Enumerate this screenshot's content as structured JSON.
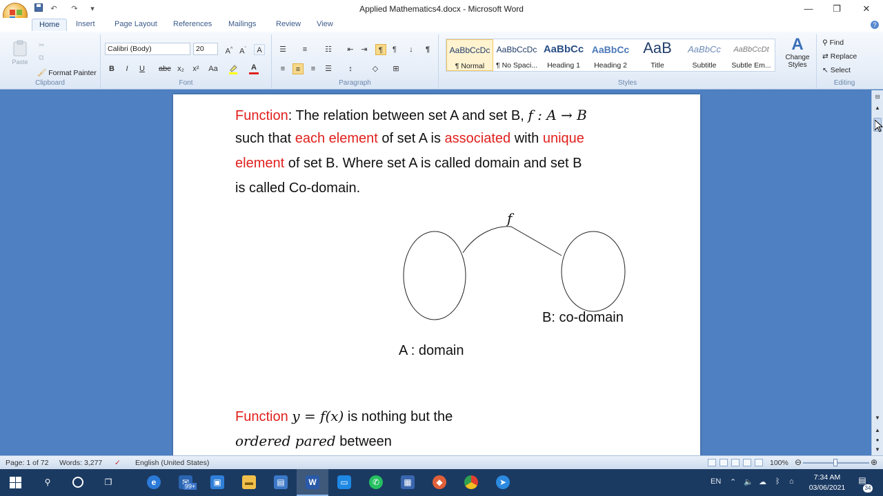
{
  "window": {
    "title": "Applied Mathematics4.docx - Microsoft Word",
    "minimize": "—",
    "restore": "❐",
    "close": "✕"
  },
  "tabs": [
    {
      "label": "Home",
      "active": true
    },
    {
      "label": "Insert"
    },
    {
      "label": "Page Layout"
    },
    {
      "label": "References"
    },
    {
      "label": "Mailings"
    },
    {
      "label": "Review"
    },
    {
      "label": "View"
    }
  ],
  "ribbon": {
    "clipboard": {
      "paste": "Paste",
      "format_painter": "Format Painter",
      "label": "Clipboard"
    },
    "font": {
      "name": "Calibri (Body)",
      "size": "20",
      "label": "Font",
      "bold": "B",
      "italic": "I",
      "underline": "U",
      "change_case": "Aa"
    },
    "paragraph": {
      "label": "Paragraph"
    },
    "styles": {
      "label": "Styles",
      "items": [
        {
          "sample": "AaBbCcDc",
          "name": "¶ Normal"
        },
        {
          "sample": "AaBbCcDc",
          "name": "¶ No Spaci..."
        },
        {
          "sample": "AaBbCc",
          "name": "Heading 1"
        },
        {
          "sample": "AaBbCc",
          "name": "Heading 2"
        },
        {
          "sample": "AaB",
          "name": "Title"
        },
        {
          "sample": "AaBbCc",
          "name": "Subtitle"
        },
        {
          "sample": "AaBbCcDt",
          "name": "Subtle Em..."
        }
      ],
      "change_styles": "Change Styles"
    },
    "editing": {
      "find": "Find",
      "replace": "Replace",
      "select": "Select",
      "label": "Editing"
    }
  },
  "document": {
    "line1": {
      "red": "Function",
      "rest": ": The relation between set A and set B, ",
      "math": "f : A → B"
    },
    "line2": {
      "a": "such that ",
      "b_red": "each element",
      "c": " of set A is ",
      "d_red": "associated",
      "e": " with ",
      "f_red": "unique"
    },
    "line3": {
      "a_red": "element",
      "b": " of set B. Where set A is called domain and set B"
    },
    "line4": "is called Co-domain.",
    "diagram": {
      "f_label": "f",
      "codomain_label": "B: co-domain",
      "domain_label": "A : domain"
    },
    "line5": {
      "red": "Function",
      "math": "y = f(x)",
      "rest": " is nothing but the"
    },
    "line6": {
      "math": "ordered pared",
      "rest": " between"
    }
  },
  "statusbar": {
    "page": "Page: 1 of 72",
    "words": "Words: 3,277",
    "language": "English (United States)",
    "zoom": "100%"
  },
  "taskbar": {
    "mail_badge": "99+",
    "tray_lang": "EN",
    "time": "7:34 AM",
    "date": "03/06/2021",
    "notifications": "34"
  }
}
